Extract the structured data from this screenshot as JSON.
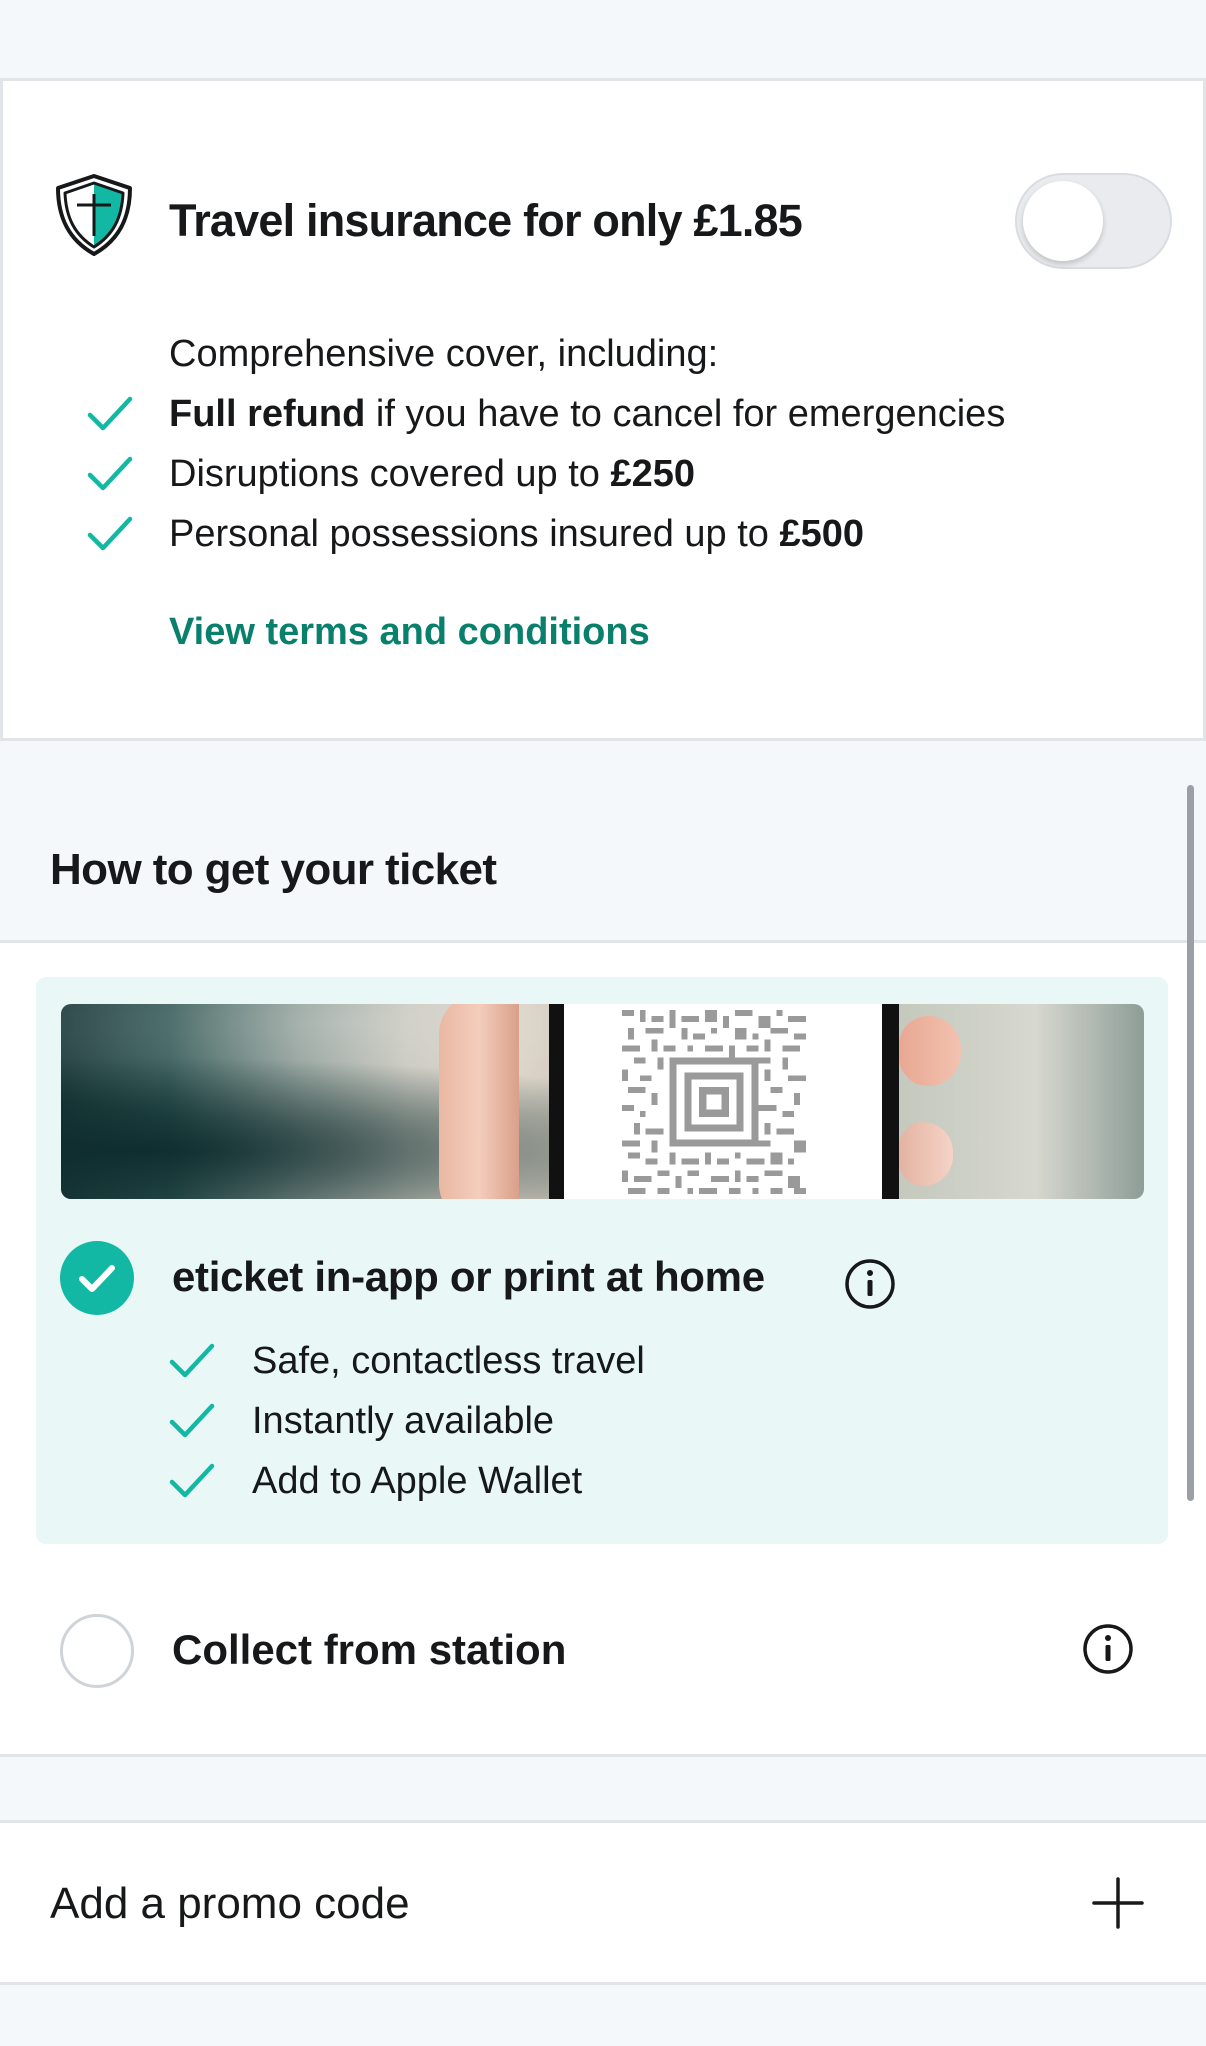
{
  "colors": {
    "accent": "#12b8a3",
    "link": "#08806c",
    "selected_bg": "#e9f8f7",
    "page_bg": "#f5f8fb"
  },
  "insurance": {
    "icon": "shield-icon",
    "title": "Travel insurance for only £1.85",
    "toggle_on": false,
    "intro": "Comprehensive cover, including:",
    "features": [
      {
        "bold": "Full refund",
        "text": " if you have to cancel for emergencies"
      },
      {
        "text": "Disruptions covered up to ",
        "bold": "£250"
      },
      {
        "text": "Personal possessions insured up to ",
        "bold": "£500"
      }
    ],
    "terms_link": "View terms and conditions"
  },
  "ticket": {
    "heading": "How to get your ticket",
    "options": [
      {
        "label": "eticket in-app or print at home",
        "selected": true,
        "image": "phone-showing-qr-code",
        "features": [
          "Safe, contactless travel",
          "Instantly available",
          "Add to Apple Wallet"
        ]
      },
      {
        "label": "Collect from station",
        "selected": false
      }
    ]
  },
  "promo": {
    "label": "Add a promo code",
    "icon": "plus-icon"
  }
}
